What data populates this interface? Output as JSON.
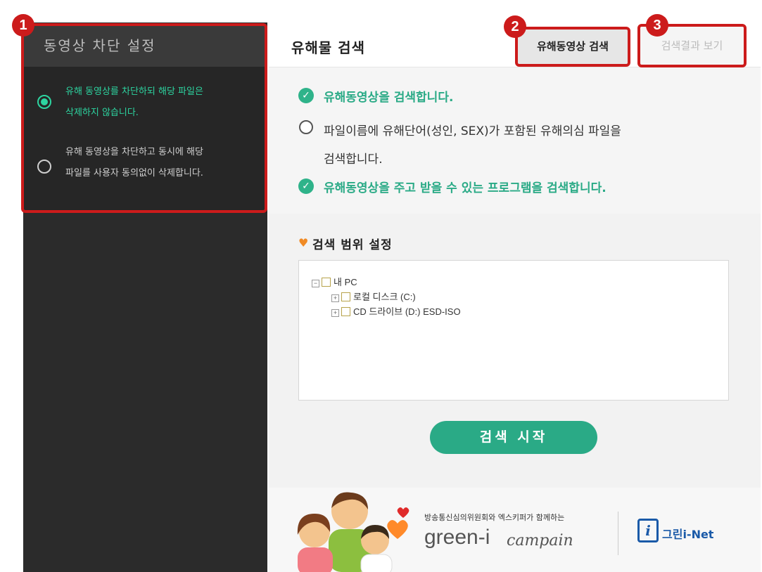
{
  "left_panel": {
    "title": "동영상 차단 설정",
    "option1_line1": "유해 동영상를 차단하되 해당 파일은",
    "option1_line2": "삭제하지 않습니다.",
    "option2_line1": "유해 동영상을 차단하고 동시에 해당",
    "option2_line2": "파일를 사용자 동의없이 삭제합니다."
  },
  "callouts": [
    "1",
    "2",
    "3"
  ],
  "right_panel": {
    "title": "유해물 검색",
    "tab_search": "유해동영상 검색",
    "tab_results": "검색결과 보기",
    "check1": "유해동영상을 검색합니다.",
    "check2_line1": "파일이름에 유해단어(성인, SEX)가 포함된 유해의심 파일을",
    "check2_line2": "검색합니다.",
    "check3": "유해동영상을 주고 받을 수 있는 프로그램을 검색합니다."
  },
  "scope": {
    "title": "검색 범위 설정",
    "tree": [
      "내 PC",
      "로컬 디스크 (C:)",
      "CD 드라이브 (D:) ESD-ISO"
    ]
  },
  "start_button": "검색 시작",
  "banner": {
    "small_text": "방송통신심의위원회와 엑스키퍼가 함께하는",
    "green_text": "green-i",
    "campain_text": "campain",
    "logo_mark": "i",
    "logo_text": "그린i-Net"
  },
  "colors": {
    "accent_green": "#2aaa86",
    "callout_red": "#cc1b1b",
    "left_bg": "#2b2b2b"
  }
}
